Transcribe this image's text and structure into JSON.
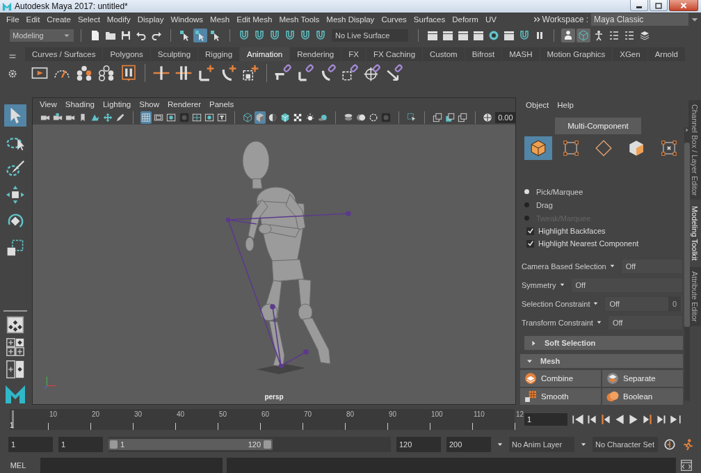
{
  "window": {
    "title": "Autodesk Maya 2017: untitled*"
  },
  "menu_bar": [
    "File",
    "Edit",
    "Create",
    "Select",
    "Modify",
    "Display",
    "Windows",
    "Mesh",
    "Edit Mesh",
    "Mesh Tools",
    "Mesh Display",
    "Curves",
    "Surfaces",
    "Deform",
    "UV"
  ],
  "workspace": {
    "label": "Workspace :",
    "value": "Maya Classic"
  },
  "status_line": {
    "menu_set": "Modeling",
    "live_surface": "No Live Surface",
    "selection_mask": [
      {
        "selected": false
      },
      {
        "selected": true
      },
      {
        "selected": false
      }
    ],
    "panel_toggles": [
      {
        "selected": true
      },
      {
        "selected": true
      },
      {
        "selected": false
      },
      {
        "selected": false
      },
      {
        "selected": false
      },
      {
        "selected": false
      }
    ]
  },
  "shelf": {
    "tabs": [
      {
        "label": "Curves / Surfaces",
        "selected": false
      },
      {
        "label": "Polygons",
        "selected": false
      },
      {
        "label": "Sculpting",
        "selected": false
      },
      {
        "label": "Rigging",
        "selected": false
      },
      {
        "label": "Animation",
        "selected": true
      },
      {
        "label": "Rendering",
        "selected": false
      },
      {
        "label": "FX",
        "selected": false
      },
      {
        "label": "FX Caching",
        "selected": false
      },
      {
        "label": "Custom",
        "selected": false
      },
      {
        "label": "Bifrost",
        "selected": false
      },
      {
        "label": "MASH",
        "selected": false
      },
      {
        "label": "Motion Graphics",
        "selected": false
      },
      {
        "label": "XGen",
        "selected": false
      },
      {
        "label": "Arnold",
        "selected": false
      }
    ]
  },
  "toolbox": {
    "tools": [
      {
        "selected": true
      },
      {
        "selected": false
      },
      {
        "selected": false
      },
      {
        "selected": false
      },
      {
        "selected": false
      },
      {
        "selected": false
      }
    ]
  },
  "viewport": {
    "menus": [
      "View",
      "Shading",
      "Lighting",
      "Show",
      "Renderer",
      "Panels"
    ],
    "tool_buttons": [
      {
        "selected": false
      },
      {
        "selected": false
      },
      {
        "selected": false
      },
      {
        "selected": false
      },
      {
        "selected": false
      },
      {
        "selected": false
      },
      {
        "selected": false
      },
      {
        "selected": true
      },
      {
        "selected": false
      },
      {
        "selected": false
      },
      {
        "selected": false
      },
      {
        "selected": false
      },
      {
        "selected": false
      },
      {
        "selected": false
      },
      {
        "selected": false
      },
      {
        "selected": true
      },
      {
        "selected": false
      },
      {
        "selected": false
      },
      {
        "selected": false
      },
      {
        "selected": false
      },
      {
        "selected": false
      },
      {
        "selected": false
      },
      {
        "selected": false
      },
      {
        "selected": false
      },
      {
        "selected": false
      },
      {
        "selected": false
      },
      {
        "selected": false
      },
      {
        "selected": false
      },
      {
        "selected": false
      }
    ],
    "exposure": "0.00",
    "camera": "persp"
  },
  "modeling_toolkit": {
    "menus": [
      "Object",
      "Help"
    ],
    "mode": "Multi-Component",
    "component_modes": [
      {
        "selected": true
      },
      {
        "selected": false
      },
      {
        "selected": false
      },
      {
        "selected": false
      },
      {
        "selected": false
      }
    ],
    "pick_modes": [
      {
        "label": "Pick/Marquee",
        "selected": true,
        "disabled": false
      },
      {
        "label": "Drag",
        "selected": false,
        "disabled": false
      },
      {
        "label": "Tweak/Marquee",
        "selected": false,
        "disabled": true
      }
    ],
    "options": [
      {
        "label": "Highlight Backfaces",
        "checked": true
      },
      {
        "label": "Highlight Nearest Component",
        "checked": true
      }
    ],
    "settings": [
      {
        "label": "Camera Based Selection",
        "value": "Off"
      },
      {
        "label": "Symmetry",
        "value": "Off"
      },
      {
        "label": "Selection Constraint",
        "value": "Off",
        "extra": "0"
      },
      {
        "label": "Transform Constraint",
        "value": "Off"
      }
    ],
    "sections": [
      {
        "label": "Soft Selection",
        "expanded": false
      },
      {
        "label": "Mesh",
        "expanded": true
      }
    ],
    "mesh_tools": [
      "Combine",
      "Separate",
      "Smooth",
      "Boolean"
    ]
  },
  "side_tabs": [
    {
      "label": "Channel Box / Layer Editor",
      "selected": false
    },
    {
      "label": "Modeling Toolkit",
      "selected": true
    },
    {
      "label": "Attribute Editor",
      "selected": false
    }
  ],
  "time_slider": {
    "level": 0,
    "current_frame": "1",
    "labels": [
      "10",
      "20",
      "30",
      "40",
      "50",
      "60",
      "70",
      "80",
      "90",
      "100",
      "110",
      "12"
    ],
    "frame_field": "1"
  },
  "range_slider": {
    "animation_start": "1",
    "playback_start": "1",
    "range_start": "1",
    "range_end": "120",
    "playback_end": "120",
    "animation_end": "200",
    "anim_layer": "No Anim Layer",
    "character_set": "No Character Set"
  },
  "command_line": {
    "language": "MEL"
  }
}
